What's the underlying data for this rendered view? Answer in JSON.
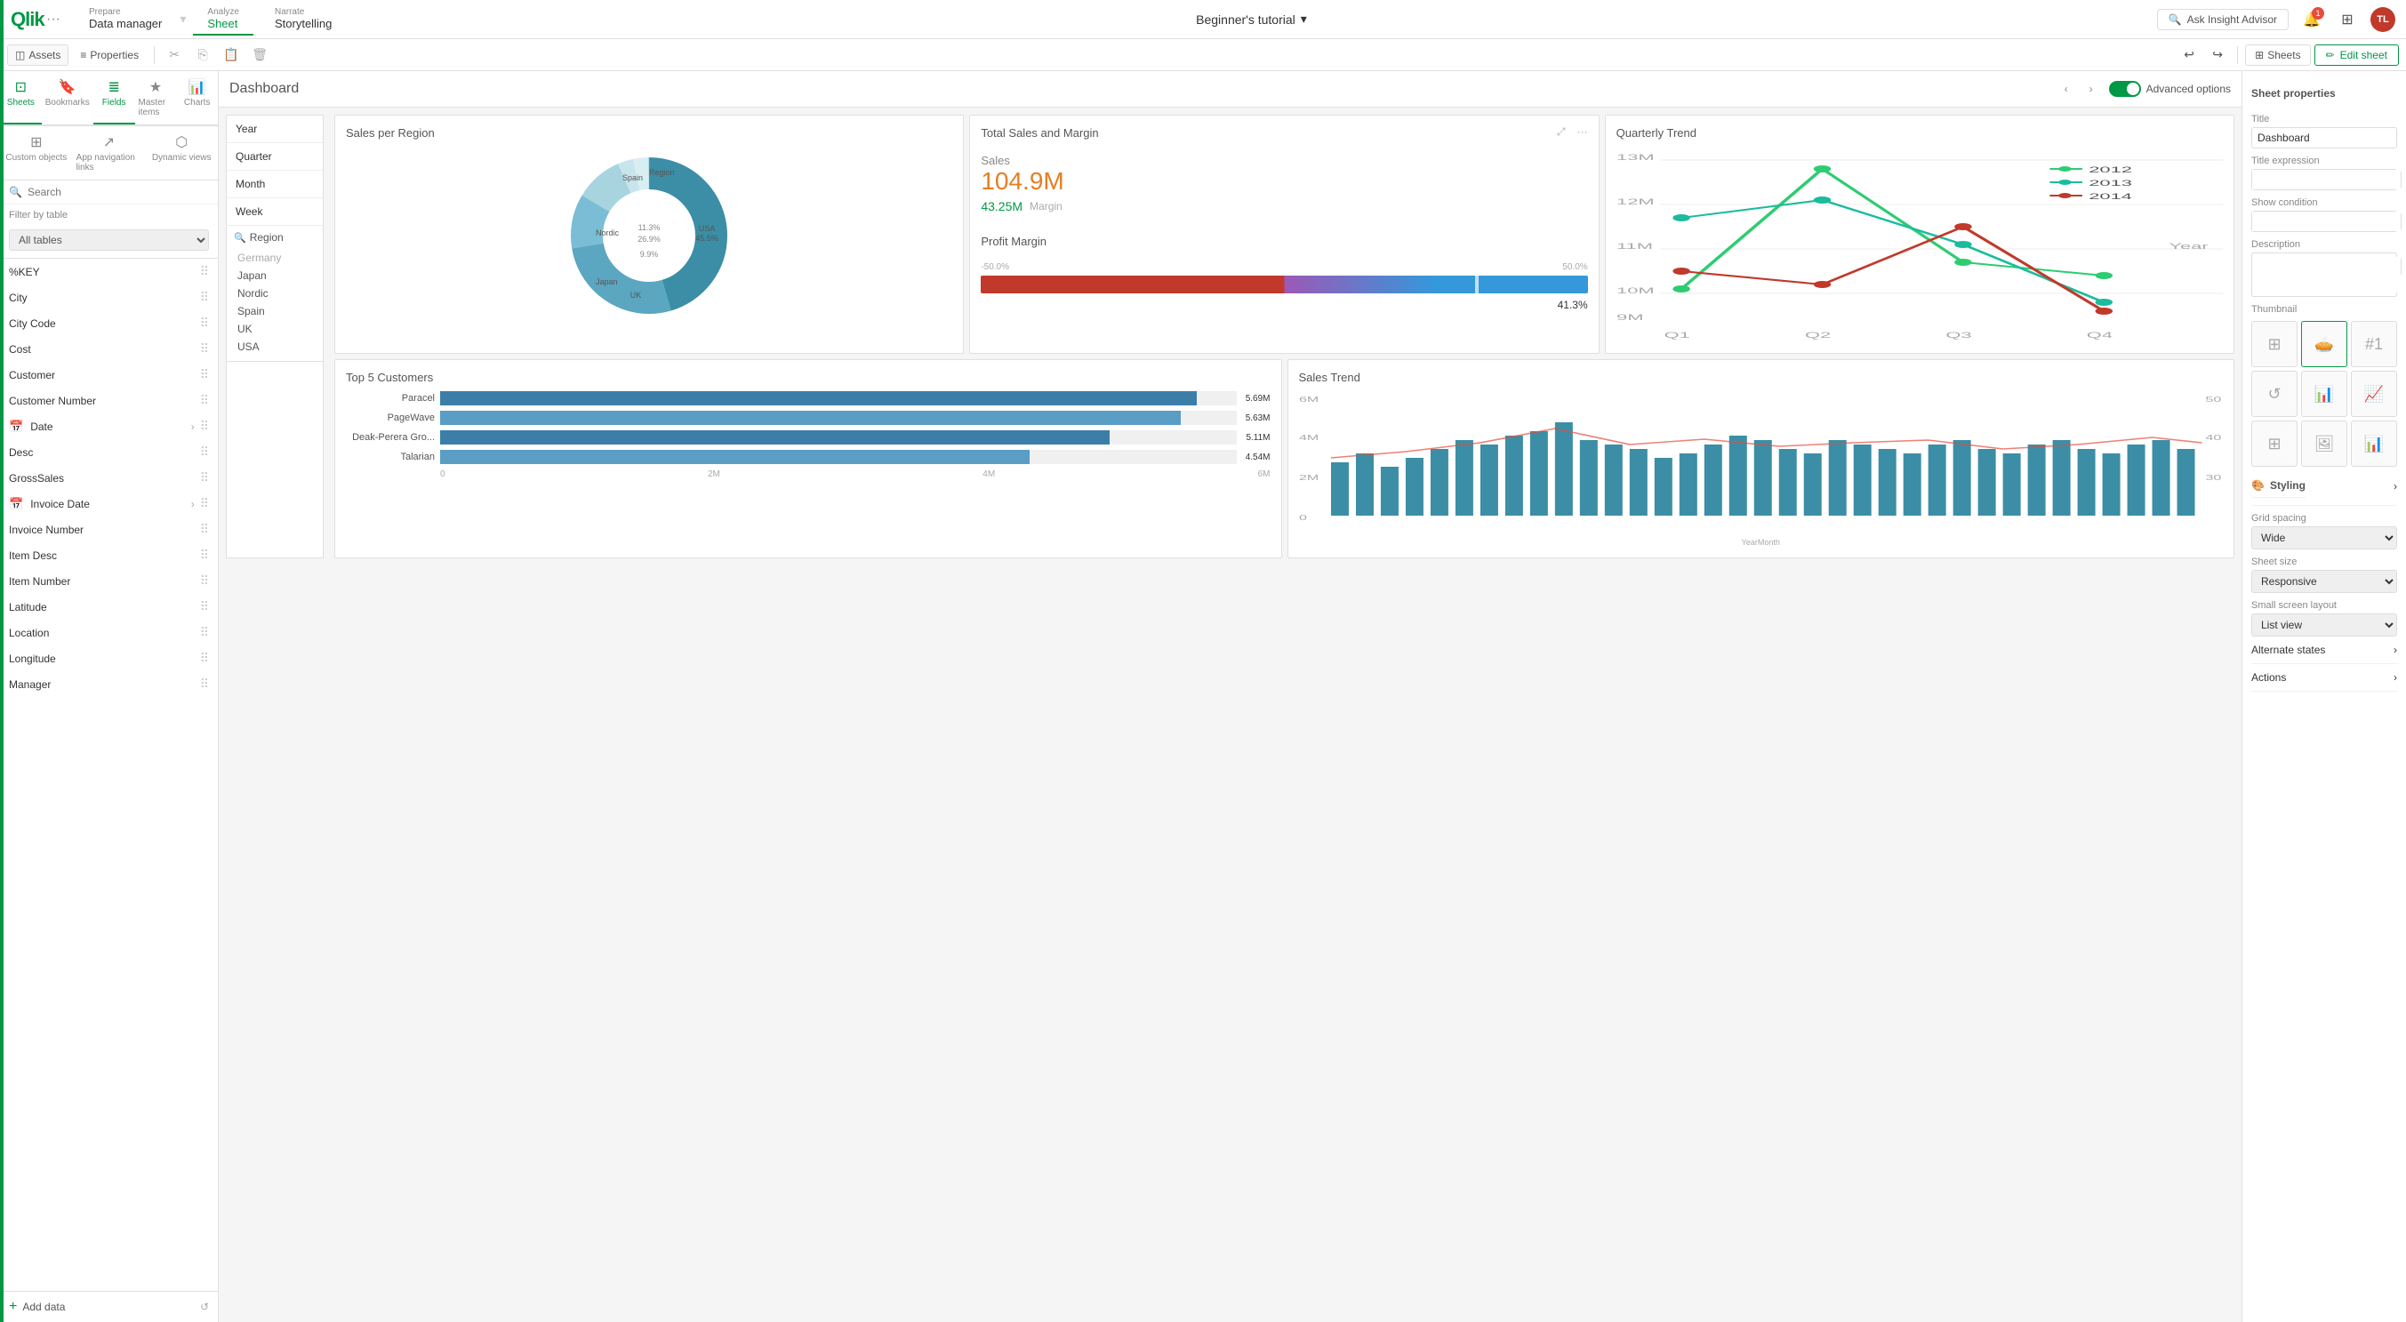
{
  "app": {
    "logo": "Qlik",
    "nav": [
      {
        "id": "prepare",
        "top": "Prepare",
        "bottom": "Data manager",
        "active": false
      },
      {
        "id": "analyze",
        "top": "Analyze",
        "bottom": "Sheet",
        "active": true
      },
      {
        "id": "narrate",
        "top": "Narrate",
        "bottom": "Storytelling",
        "active": false
      }
    ],
    "title": "Beginner's tutorial",
    "insight_advisor": "Ask Insight Advisor",
    "sheets_btn": "Sheets",
    "edit_sheet_btn": "Edit sheet"
  },
  "toolbar": {
    "assets_label": "Assets",
    "properties_label": "Properties",
    "undo_label": "Undo",
    "redo_label": "Redo"
  },
  "sidebar": {
    "search_placeholder": "Search",
    "filter_by_label": "Filter by table",
    "filter_option": "All tables",
    "fields": [
      {
        "name": "%KEY",
        "has_date": false
      },
      {
        "name": "City",
        "has_date": false
      },
      {
        "name": "City Code",
        "has_date": false
      },
      {
        "name": "Cost",
        "has_date": false
      },
      {
        "name": "Customer",
        "has_date": false
      },
      {
        "name": "Customer Number",
        "has_date": false
      },
      {
        "name": "Date",
        "has_date": true
      },
      {
        "name": "Desc",
        "has_date": false
      },
      {
        "name": "GrossSales",
        "has_date": false
      },
      {
        "name": "Invoice Date",
        "has_date": true
      },
      {
        "name": "Invoice Number",
        "has_date": false
      },
      {
        "name": "Item Desc",
        "has_date": false
      },
      {
        "name": "Item Number",
        "has_date": false
      },
      {
        "name": "Latitude",
        "has_date": false
      },
      {
        "name": "Location",
        "has_date": false
      },
      {
        "name": "Longitude",
        "has_date": false
      },
      {
        "name": "Manager",
        "has_date": false
      }
    ],
    "dynamic_views_label": "Dynamic views",
    "add_data_label": "Add data"
  },
  "filter_panel": {
    "items": [
      "Year",
      "Quarter",
      "Month",
      "Week"
    ],
    "region_label": "Region",
    "regions": [
      "Germany",
      "Japan",
      "Nordic",
      "Spain",
      "UK",
      "USA"
    ]
  },
  "dashboard": {
    "title": "Dashboard",
    "charts": {
      "sales_per_region": {
        "title": "Sales per Region",
        "segments": [
          {
            "label": "USA",
            "value": 45.5,
            "color": "#3b8ea5"
          },
          {
            "label": "UK",
            "value": 26.9,
            "color": "#5ba6c0"
          },
          {
            "label": "Japan",
            "value": 11.3,
            "color": "#7abdd4"
          },
          {
            "label": "Nordic",
            "value": 9.9,
            "color": "#a8d4e0"
          },
          {
            "label": "Spain",
            "value": 3.2,
            "color": "#c8e5ed"
          },
          {
            "label": "Germany",
            "value": 3.2,
            "color": "#d8eef3"
          }
        ]
      },
      "top5_customers": {
        "title": "Top 5 Customers",
        "items": [
          {
            "name": "Paracel",
            "value": 5690000,
            "label": "5.69M",
            "pct": 95
          },
          {
            "name": "PageWave",
            "value": 5630000,
            "label": "5.63M",
            "pct": 93
          },
          {
            "name": "Deak-Perera Gro...",
            "value": 5110000,
            "label": "5.11M",
            "pct": 84
          },
          {
            "name": "Talarian",
            "value": 4540000,
            "label": "4.54M",
            "pct": 74
          }
        ],
        "x_labels": [
          "0",
          "2M",
          "4M",
          "6M"
        ]
      },
      "total_sales": {
        "title": "Total Sales and Margin",
        "sales_label": "Sales",
        "sales_value": "104.9M",
        "margin_value": "43.25M",
        "margin_suffix": "Margin",
        "margin_pct": "41.3%"
      },
      "profit_margin": {
        "title": "Profit Margin",
        "left_label": "-50.0%",
        "right_label": "50.0%",
        "pct": "41.3%"
      },
      "quarterly_trend": {
        "title": "Quarterly Trend",
        "year_label": "Year",
        "years": [
          "2012",
          "2013",
          "2014"
        ],
        "quarters": [
          "Q1",
          "Q2",
          "Q3",
          "Q4"
        ]
      },
      "sales_trend": {
        "title": "Sales Trend",
        "y_labels": [
          "0",
          "2M",
          "4M",
          "6M"
        ],
        "y_right_labels": [
          "30",
          "40",
          "50"
        ],
        "x_label": "YearMonth"
      }
    }
  },
  "right_panel": {
    "title": "Sheet properties",
    "title_label": "Title",
    "title_value": "Dashboard",
    "title_expression_label": "Title expression",
    "show_condition_label": "Show condition",
    "description_label": "Description",
    "thumbnail_label": "Thumbnail",
    "styling_label": "Styling",
    "grid_spacing_label": "Grid spacing",
    "grid_spacing_value": "Wide",
    "sheet_size_label": "Sheet size",
    "sheet_size_value": "Responsive",
    "small_screen_label": "Small screen layout",
    "small_screen_value": "List view",
    "alternate_states_label": "Alternate states",
    "actions_label": "Actions"
  }
}
